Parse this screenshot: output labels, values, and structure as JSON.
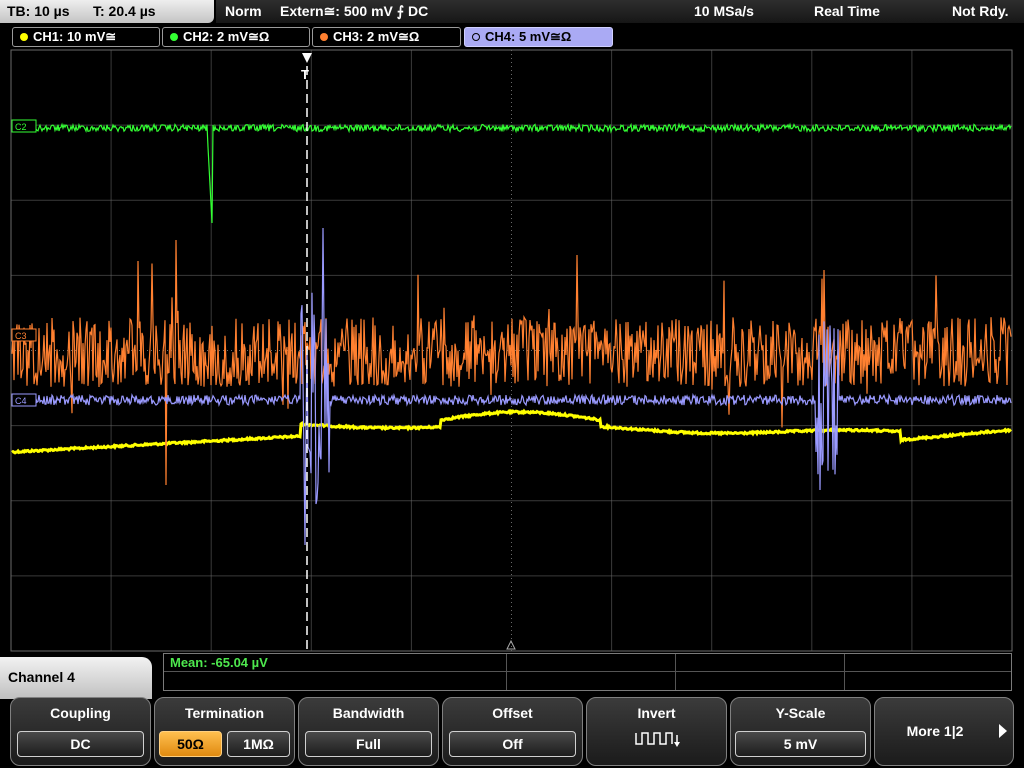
{
  "status_bar": {
    "timebase": "TB: 10 µs",
    "trigger_time": "T: 20.4 µs",
    "trigger_mode": "Norm",
    "trigger_source": "Extern≅: 500 mV ⨍ DC",
    "sample_rate": "10 MSa/s",
    "acquisition_mode": "Real Time",
    "state": "Not Rdy."
  },
  "channels": [
    {
      "label": "CH1: 10 mV≅",
      "color": "#ffff00"
    },
    {
      "label": "CH2: 2 mV≅Ω",
      "color": "#33ff33"
    },
    {
      "label": "CH3: 2 mV≅Ω",
      "color": "#ff8030"
    },
    {
      "label": "CH4: 5 mV≅Ω",
      "color": "#9a9aff"
    }
  ],
  "waveform_markers": {
    "ch2": "C2",
    "ch3": "C3",
    "ch4": "C4",
    "trigger": "T"
  },
  "measurement": {
    "mean": "Mean: -65.04 µV"
  },
  "menu": {
    "title": "Channel 4",
    "coupling": {
      "label": "Coupling",
      "value": "DC"
    },
    "termination": {
      "label": "Termination",
      "options": [
        "50Ω",
        "1MΩ"
      ],
      "selected": "50Ω"
    },
    "bandwidth": {
      "label": "Bandwidth",
      "value": "Full"
    },
    "offset": {
      "label": "Offset",
      "value": "Off"
    },
    "invert": {
      "label": "Invert",
      "icon": "inverted-square-wave-icon"
    },
    "y_scale": {
      "label": "Y-Scale",
      "value": "5 mV"
    },
    "more": {
      "label": "More 1|2",
      "icon": "arrow-right-icon"
    }
  }
}
